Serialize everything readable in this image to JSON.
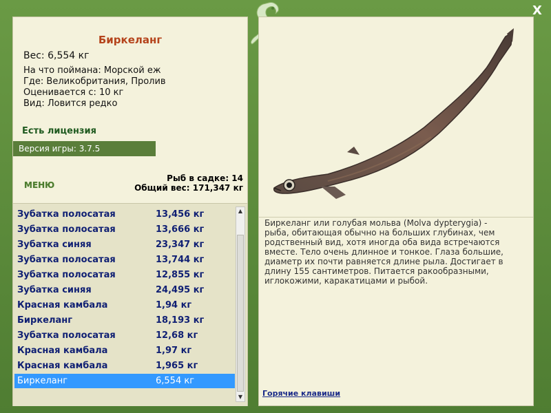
{
  "window": {
    "close_label": "X"
  },
  "fish": {
    "title": "Биркеланг",
    "weight_line": "Вес: 6,554 кг",
    "caught_on": "На что поймана: Морской еж",
    "location": "Где: Великобритания, Пролив",
    "rated_from": "Оценивается с: 10 кг",
    "kind": "Вид: Ловится редко"
  },
  "license_text": "Есть лицензия",
  "version_text": "Версия игры: 3.7.5",
  "menu_label": "МЕНЮ",
  "keep": {
    "count_text": "Рыб в садке: 14",
    "total_text": "Общий вес: 171,347 кг"
  },
  "catch_list": [
    {
      "name": "Зубатка полосатая",
      "weight": "13,456 кг"
    },
    {
      "name": "Зубатка полосатая",
      "weight": "13,666 кг"
    },
    {
      "name": "Зубатка синяя",
      "weight": "23,347 кг"
    },
    {
      "name": "Зубатка полосатая",
      "weight": "13,744 кг"
    },
    {
      "name": "Зубатка полосатая",
      "weight": "12,855 кг"
    },
    {
      "name": "Зубатка синяя",
      "weight": "24,495 кг"
    },
    {
      "name": "Красная камбала",
      "weight": "1,94 кг"
    },
    {
      "name": "Биркеланг",
      "weight": "18,193 кг"
    },
    {
      "name": "Зубатка полосатая",
      "weight": "12,68 кг"
    },
    {
      "name": "Красная камбала",
      "weight": "1,97 кг"
    },
    {
      "name": "Красная камбала",
      "weight": "1,965 кг"
    },
    {
      "name": "Биркеланг",
      "weight": "6,554 кг",
      "selected": true
    }
  ],
  "description": "Биркеланг или голубая мольва (Molva dypterygia) - рыба, обитающая обычно на больших глубинах, чем родственный вид, хотя иногда оба вида встречаются вместе. Тело очень длинное и тонкое. Глаза большие, диаметр их почти равняется длине рыла. Достигает в длину 155 сантиметров. Питается ракообразными, иглокожими, каракатицами и рыбой.",
  "hotkeys_label": "Горячие клавиши",
  "colors": {
    "frame": "#5d8a3a",
    "panel": "#f4f2dc",
    "title": "#b5441c",
    "list_text": "#0f1f73",
    "selected": "#3399ff",
    "license": "#1f5a1f"
  }
}
